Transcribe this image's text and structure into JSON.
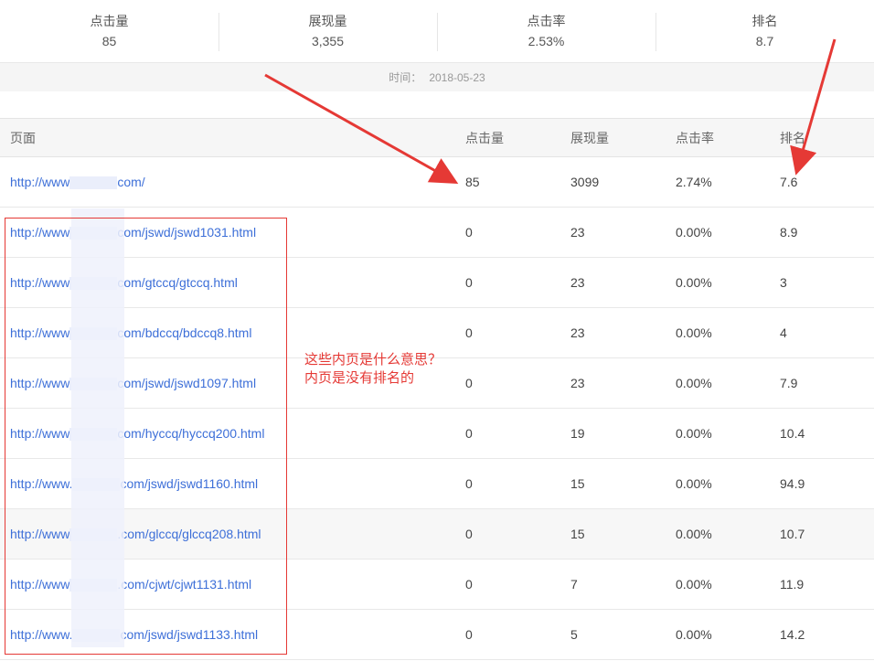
{
  "summary": [
    {
      "label": "点击量",
      "value": "85"
    },
    {
      "label": "展现量",
      "value": "3,355"
    },
    {
      "label": "点击率",
      "value": "2.53%"
    },
    {
      "label": "排名",
      "value": "8.7"
    }
  ],
  "date": {
    "label": "时间：",
    "value": "2018-05-23"
  },
  "table": {
    "headers": [
      "页面",
      "点击量",
      "展现量",
      "点击率",
      "排名"
    ],
    "rows": [
      {
        "url_prefix": "http://www",
        "url_suffix": "com/",
        "clicks": "85",
        "impressions": "3099",
        "ctr": "2.74%",
        "rank": "7.6"
      },
      {
        "url_prefix": "http://www",
        "url_suffix": "com/jswd/jswd1031.html",
        "clicks": "0",
        "impressions": "23",
        "ctr": "0.00%",
        "rank": "8.9"
      },
      {
        "url_prefix": "http://www",
        "url_suffix": "com/gtccq/gtccq.html",
        "clicks": "0",
        "impressions": "23",
        "ctr": "0.00%",
        "rank": "3"
      },
      {
        "url_prefix": "http://www",
        "url_suffix": "com/bdccq/bdccq8.html",
        "clicks": "0",
        "impressions": "23",
        "ctr": "0.00%",
        "rank": "4"
      },
      {
        "url_prefix": "http://www",
        "url_suffix": "com/jswd/jswd1097.html",
        "clicks": "0",
        "impressions": "23",
        "ctr": "0.00%",
        "rank": "7.9"
      },
      {
        "url_prefix": "http://www",
        "url_suffix": "com/hyccq/hyccq200.html",
        "clicks": "0",
        "impressions": "19",
        "ctr": "0.00%",
        "rank": "10.4"
      },
      {
        "url_prefix": "http://www.",
        "url_suffix": "com/jswd/jswd1160.html",
        "clicks": "0",
        "impressions": "15",
        "ctr": "0.00%",
        "rank": "94.9"
      },
      {
        "url_prefix": "http://www",
        "url_suffix": ".com/glccq/glccq208.html",
        "clicks": "0",
        "impressions": "15",
        "ctr": "0.00%",
        "rank": "10.7"
      },
      {
        "url_prefix": "http://www",
        "url_suffix": ".com/cjwt/cjwt1131.html",
        "clicks": "0",
        "impressions": "7",
        "ctr": "0.00%",
        "rank": "11.9"
      },
      {
        "url_prefix": "http://www.",
        "url_suffix": "com/jswd/jswd1133.html",
        "clicks": "0",
        "impressions": "5",
        "ctr": "0.00%",
        "rank": "14.2"
      }
    ]
  },
  "annotation": {
    "line1": "这些内页是什么意思？",
    "line2": "内页是没有排名的",
    "color": "#e53935"
  },
  "colors": {
    "link": "#3d6fd8",
    "header_bg": "#f6f6f6"
  }
}
